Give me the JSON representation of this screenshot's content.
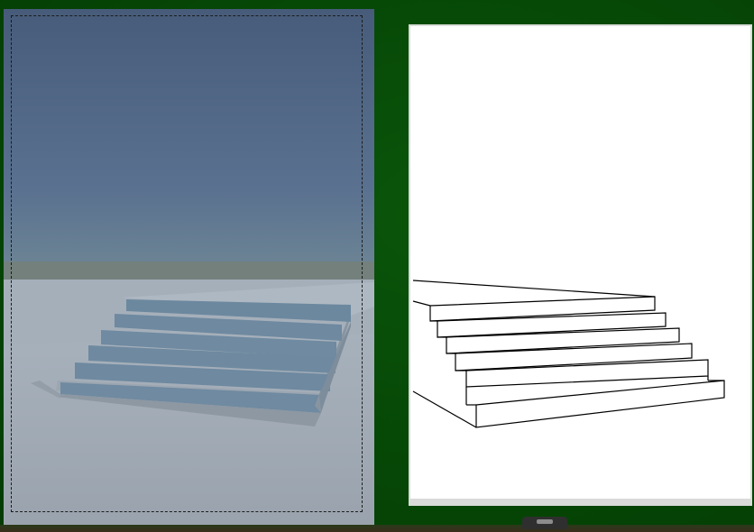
{
  "workspace": {
    "background_color": "#064a06",
    "render_image_description_icon": "stairs-render",
    "lineart_image_icon": "stairs-line-drawing"
  },
  "colors": {
    "sky_top": "#4b6382",
    "horizon": "#6b7f78",
    "ground": "#a9b3be",
    "step_face": "#6d8aa2",
    "line": "#000000",
    "paper": "#ffffff"
  }
}
